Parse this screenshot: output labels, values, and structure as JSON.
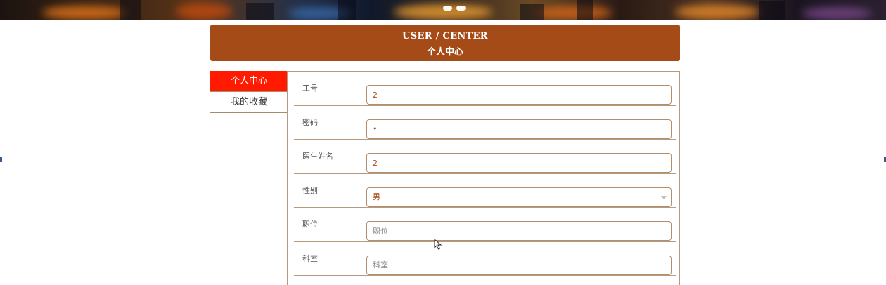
{
  "banner": {
    "active_slide": 1,
    "slide_count": 2
  },
  "header": {
    "title_en": "USER / CENTER",
    "title_cn": "个人中心",
    "color": "#a54b17"
  },
  "sidebar": {
    "items": [
      {
        "label": "个人中心",
        "active": true
      },
      {
        "label": "我的收藏",
        "active": false
      }
    ],
    "active_color": "#ff1a00"
  },
  "form": {
    "fields": [
      {
        "label": "工号",
        "value": "2",
        "placeholder": ""
      },
      {
        "label": "密码",
        "value": "•",
        "placeholder": ""
      },
      {
        "label": "医生姓名",
        "value": "2",
        "placeholder": ""
      },
      {
        "label": "性别",
        "value": "男",
        "type": "select"
      },
      {
        "label": "职位",
        "value": "",
        "placeholder": "职位"
      },
      {
        "label": "科室",
        "value": "",
        "placeholder": "科室"
      }
    ]
  }
}
